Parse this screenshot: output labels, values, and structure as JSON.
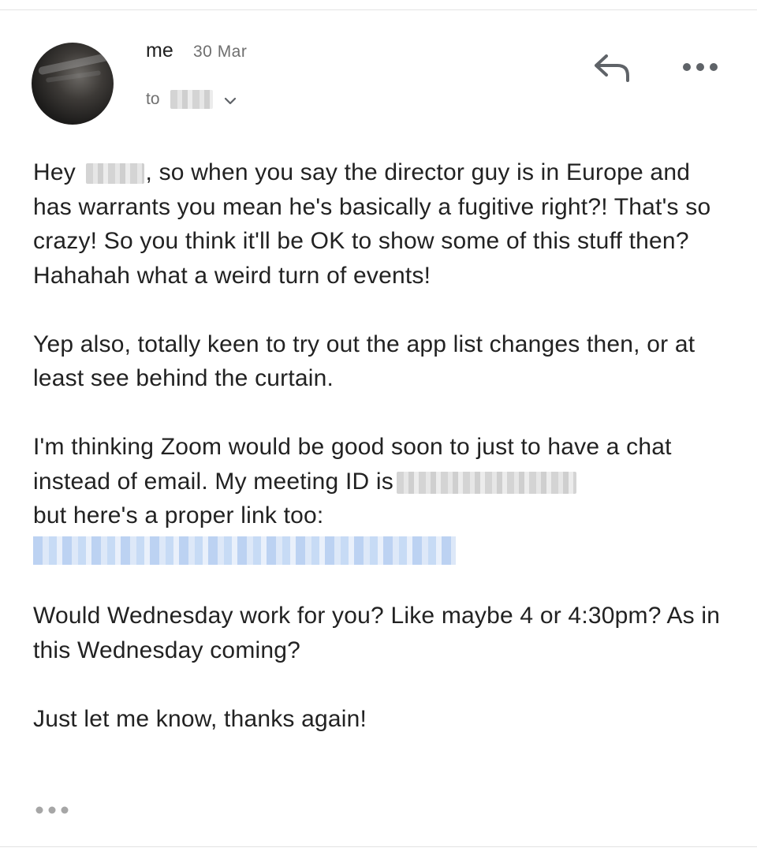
{
  "header": {
    "sender": "me",
    "date": "30 Mar",
    "to_label": "to"
  },
  "icons": {
    "reply": "reply-arrow-icon",
    "more": "more-horizontal-icon",
    "expand_recipients": "chevron-down-icon",
    "expand_quoted": "ellipsis-icon"
  },
  "body": {
    "p1_a": "Hey ",
    "p1_b": ", so when you say the director guy is in Europe and has warrants you mean he's basically a fugitive right?! That's so crazy! So you think it'll be OK to show some of this stuff then? Hahahah what a weird turn of events!",
    "p2": "Yep also, totally keen to try out the app list changes then, or at least see behind the curtain.",
    "p3_a": "I'm thinking Zoom would be good soon to just to have a chat instead of email. My meeting ID is",
    "p3_b": "but here's a proper link too:",
    "p4": "Would Wednesday work for you? Like maybe 4 or 4:30pm? As in this Wednesday coming?",
    "p5": "Just let me know, thanks again!"
  },
  "colors": {
    "text": "#222222",
    "secondary": "#6f6f6f",
    "icon": "#5f6368",
    "link_blur": "#bcd2f2"
  }
}
